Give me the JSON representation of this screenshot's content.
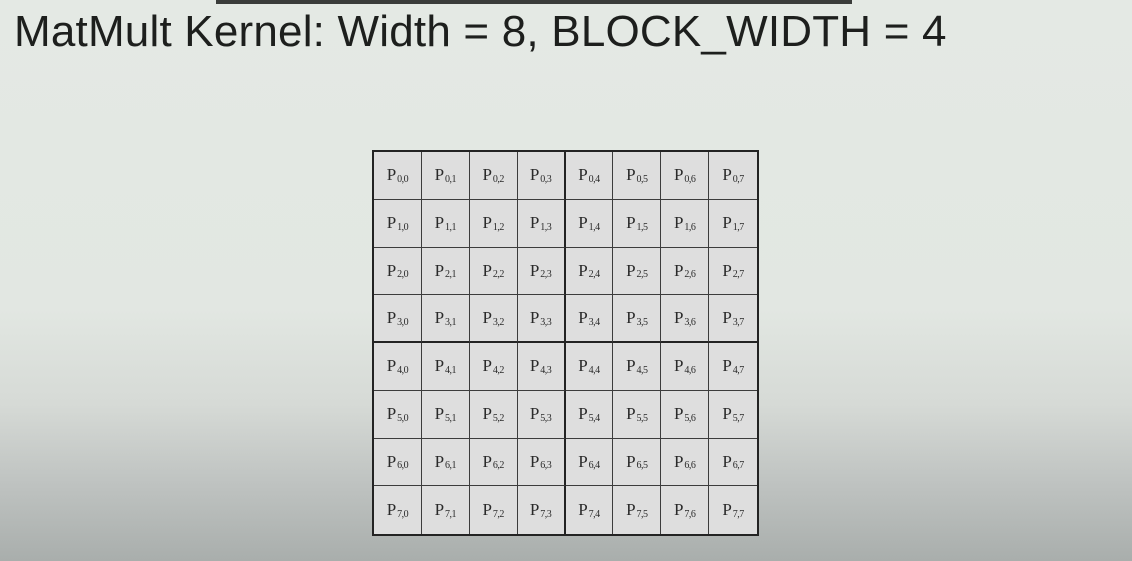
{
  "slide": {
    "title": "MatMult Kernel: Width = 8, BLOCK_WIDTH = 4"
  },
  "matrix": {
    "letter": "P",
    "rows": [
      [
        "0,0",
        "0,1",
        "0,2",
        "0,3",
        "0,4",
        "0,5",
        "0,6",
        "0,7"
      ],
      [
        "1,0",
        "1,1",
        "1,2",
        "1,3",
        "1,4",
        "1,5",
        "1,6",
        "1,7"
      ],
      [
        "2,0",
        "2,1",
        "2,2",
        "2,3",
        "2,4",
        "2,5",
        "2,6",
        "2,7"
      ],
      [
        "3,0",
        "3,1",
        "3,2",
        "3,3",
        "3,4",
        "3,5",
        "3,6",
        "3,7"
      ],
      [
        "4,0",
        "4,1",
        "4,2",
        "4,3",
        "4,4",
        "4,5",
        "4,6",
        "4,7"
      ],
      [
        "5,0",
        "5,1",
        "5,2",
        "5,3",
        "5,4",
        "5,5",
        "5,6",
        "5,7"
      ],
      [
        "6,0",
        "6,1",
        "6,2",
        "6,3",
        "6,4",
        "6,5",
        "6,6",
        "6,7"
      ],
      [
        "7,0",
        "7,1",
        "7,2",
        "7,3",
        "7,4",
        "7,5",
        "7,6",
        "7,7"
      ]
    ]
  }
}
